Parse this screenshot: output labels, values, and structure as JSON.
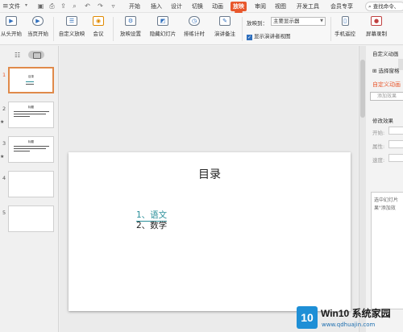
{
  "titlebar": {
    "file_menu": "文件",
    "tabs": [
      "开始",
      "插入",
      "设计",
      "切换",
      "动画",
      "放映",
      "审阅",
      "视图",
      "开发工具",
      "会员专享"
    ],
    "active_tab": "放映",
    "search_text": "查找命令、"
  },
  "ribbon": {
    "buttons": [
      "从头开始",
      "当页开始",
      "自定义放映",
      "会议",
      "放映设置",
      "隐藏幻灯片",
      "排练计时",
      "演讲备注",
      "手机遥控",
      "屏幕录制"
    ],
    "play_to_label": "放映到：",
    "play_to_value": "主要显示器",
    "presenter_view_label": "显示演讲者视图",
    "presenter_view_checked": true
  },
  "thumbnails": {
    "slides": [
      {
        "num": "1",
        "title": "目录"
      },
      {
        "num": "2",
        "title": "标题"
      },
      {
        "num": "3",
        "title": "标题"
      },
      {
        "num": "4",
        "title": ""
      },
      {
        "num": "5",
        "title": ""
      }
    ],
    "star": "★"
  },
  "slide": {
    "title": "目录",
    "items": [
      "1、语文",
      "2、数学"
    ]
  },
  "rightpane": {
    "header": "自定义动画",
    "select_pane": "选择窗格",
    "section_title": "自定义动画",
    "add_effect": "添加效果",
    "modify_effect": "修改效果",
    "start_label": "开始:",
    "property_label": "属性:",
    "speed_label": "速度:",
    "note_lines": [
      "选中幻灯片",
      "果\"添加效"
    ]
  },
  "watermark": {
    "logo_text": "10",
    "brand": "Win10 系统家园",
    "url": "www.qdhuajin.com"
  }
}
